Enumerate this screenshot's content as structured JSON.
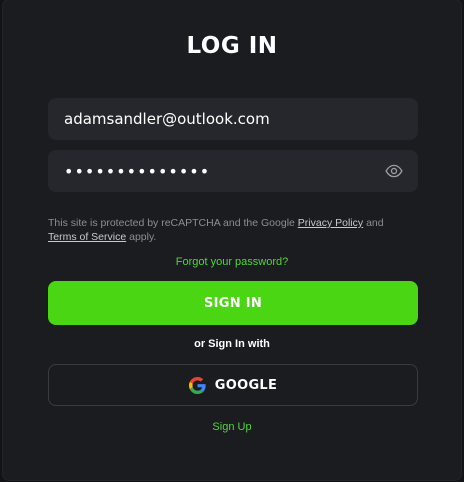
{
  "modal": {
    "title": "LOG IN"
  },
  "email": {
    "value": "adamsandler@outlook.com",
    "placeholder": ""
  },
  "password": {
    "value": "••••••••••••••",
    "icon": "eye-icon"
  },
  "recaptcha": {
    "prefix": "This site is protected by reCAPTCHA and the Google ",
    "privacy_link": "Privacy Policy",
    "middle": " and ",
    "terms_link": "Terms of Service",
    "suffix": " apply."
  },
  "forgot_password": "Forgot your password?",
  "sign_in_button": "SIGN IN",
  "or_text": "or Sign In with",
  "google_button": {
    "label": "GOOGLE",
    "icon": "google-icon"
  },
  "sign_up_link": "Sign Up",
  "colors": {
    "accent_green": "#4ad613",
    "link_green": "#52d63a",
    "modal_bg": "#1b1c20",
    "field_bg": "#26272d"
  }
}
